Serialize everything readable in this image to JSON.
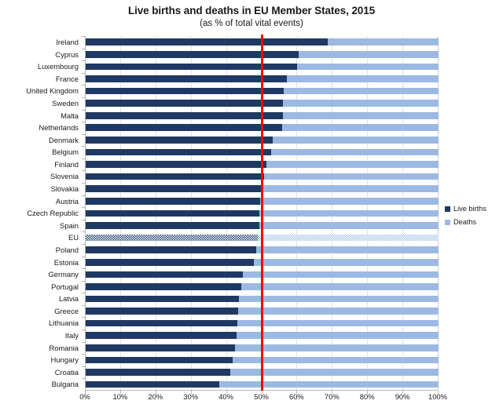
{
  "chart_data": {
    "type": "bar",
    "title": "Live births and deaths in EU Member States, 2015",
    "subtitle": "(as % of total vital events)",
    "xlabel": "",
    "ylabel": "",
    "orientation": "horizontal",
    "stacked": true,
    "xlim": [
      0,
      100
    ],
    "xtick_labels": [
      "0%",
      "10%",
      "20%",
      "30%",
      "40%",
      "50%",
      "60%",
      "70%",
      "80%",
      "90%",
      "100%"
    ],
    "xtick_values": [
      0,
      10,
      20,
      30,
      40,
      50,
      60,
      70,
      80,
      90,
      100
    ],
    "grid": "vertical",
    "legend_position": "right",
    "reference_line": {
      "value": 50,
      "color": "#ff0000",
      "label": "50%"
    },
    "categories": [
      "Ireland",
      "Cyprus",
      "Luxembourg",
      "France",
      "United Kingdom",
      "Sweden",
      "Malta",
      "Netherlands",
      "Denmark",
      "Belgium",
      "Finland",
      "Slovenia",
      "Slovakia",
      "Austria",
      "Czech Republic",
      "Spain",
      "EU",
      "Poland",
      "Estonia",
      "Germany",
      "Portugal",
      "Latvia",
      "Greece",
      "Lithuania",
      "Italy",
      "Romania",
      "Hungary",
      "Croatia",
      "Bulgaria"
    ],
    "series": [
      {
        "name": "Live births",
        "color": "#1f3864",
        "values": [
          68.7,
          60.4,
          59.8,
          57.0,
          56.2,
          56.0,
          55.8,
          55.7,
          52.9,
          52.6,
          51.2,
          50.5,
          50.4,
          49.5,
          49.3,
          49.2,
          48.8,
          48.3,
          47.6,
          44.6,
          44.0,
          43.5,
          43.2,
          43.0,
          42.8,
          42.4,
          41.6,
          41.0,
          37.8
        ]
      },
      {
        "name": "Deaths",
        "color": "#9cb9e3",
        "values": [
          31.3,
          39.6,
          40.2,
          43.0,
          43.8,
          44.0,
          44.2,
          44.3,
          47.1,
          47.4,
          48.8,
          49.5,
          49.6,
          50.5,
          50.7,
          50.8,
          51.2,
          51.7,
          52.4,
          55.4,
          56.0,
          56.5,
          56.8,
          57.0,
          57.2,
          57.6,
          58.4,
          59.0,
          62.2
        ]
      }
    ],
    "highlight_category": "EU"
  },
  "legend": {
    "items": [
      {
        "label": "Live births"
      },
      {
        "label": "Deaths"
      }
    ]
  }
}
